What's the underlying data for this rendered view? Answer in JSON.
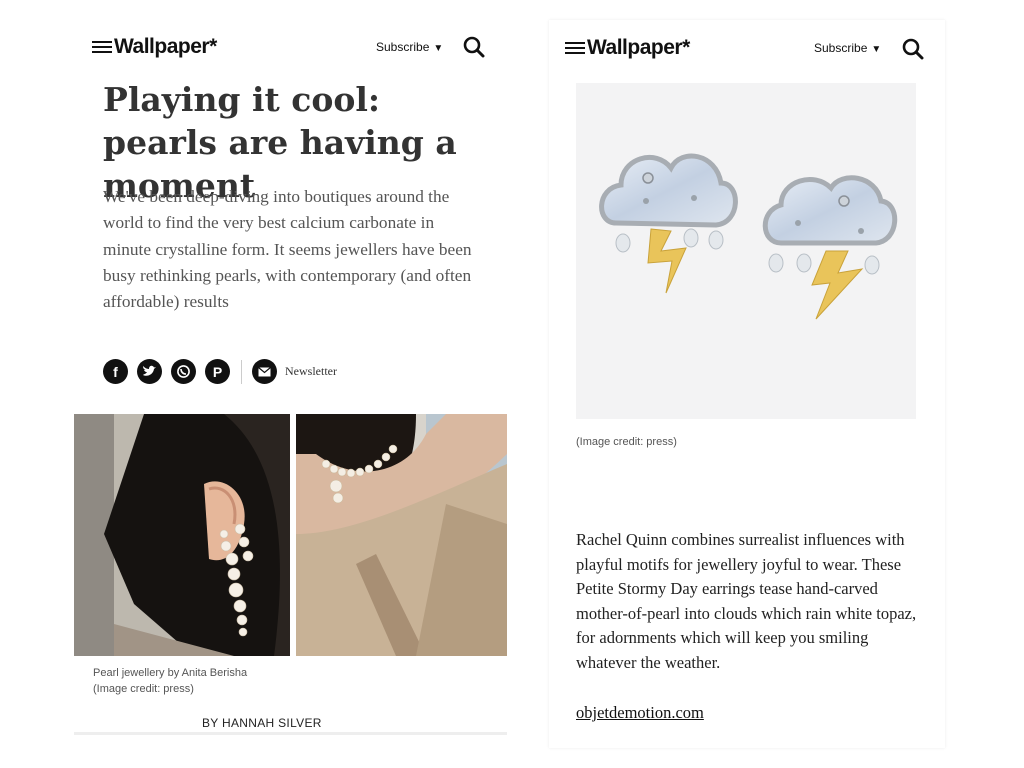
{
  "left_screen": {
    "header": {
      "logo": "Wallpaper*",
      "subscribe_label": "Subscribe"
    },
    "article": {
      "title": "Playing it cool: pearls are having a moment",
      "dek": "We've been deep-diving into boutiques around the world to find the very best calcium carbonate in minute crystalline form. It seems jewellers have been busy rethinking pearls, with contemporary (and often affordable) results"
    },
    "share": {
      "newsletter_label": "Newsletter"
    },
    "hero_caption": {
      "title": "Pearl jewellery by Anita Berisha",
      "credit": "(Image credit: press)"
    },
    "byline": "BY HANNAH SILVER"
  },
  "right_screen": {
    "header": {
      "logo": "Wallpaper*",
      "subscribe_label": "Subscribe"
    },
    "image_credit": "(Image credit: press)",
    "body": "Rachel Quinn combines surrealist influences with playful motifs for jewellery joyful to wear. These Petite Stormy Day earrings tease hand-carved mother-of-pearl into clouds which rain white topaz, for adornments which will keep you smiling whatever the weather.",
    "link": "objetdemotion.com"
  }
}
